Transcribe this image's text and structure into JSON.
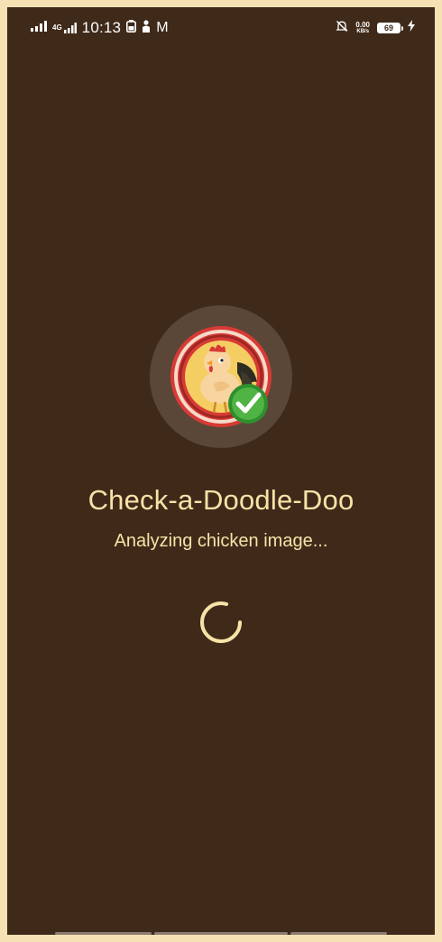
{
  "status_bar": {
    "network": "4G",
    "time": "10:13",
    "app_icon_label": "M",
    "speed_value": "0.00",
    "speed_unit": "KB/s",
    "battery": "69"
  },
  "app": {
    "title": "Check-a-Doodle-Doo",
    "status": "Analyzing chicken image...",
    "logo_icon": "chicken-check-logo",
    "accent": "#f7e3a8",
    "background": "#3f2a1a"
  },
  "icons": {
    "signal": "signal-bars-icon",
    "battery_saver": "battery-icon",
    "notification": "person-icon",
    "mute": "bell-off-icon",
    "charging": "bolt-icon"
  }
}
